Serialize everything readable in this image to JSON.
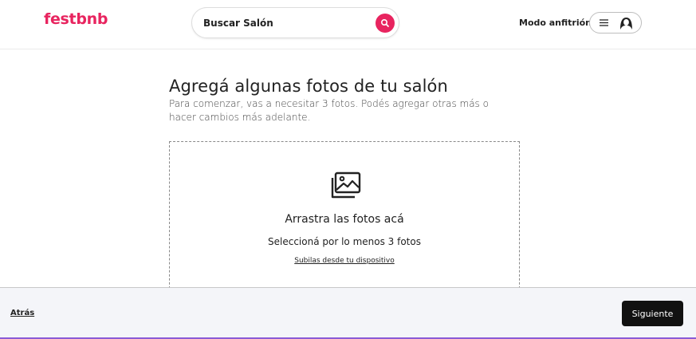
{
  "header": {
    "logo": "festbnb",
    "search": {
      "placeholder": "Buscar Salón",
      "icon": "search-icon"
    },
    "host_link": "Modo anfitrión",
    "user_menu": {
      "menu_icon": "hamburger-icon",
      "avatar_icon": "user-avatar-icon"
    }
  },
  "main": {
    "title": "Agregá algunas fotos de tu salón",
    "subtitle": "Para comenzar, vas a necesitar 3 fotos. Podés agregar otras más o hacer cambios más adelante.",
    "dropzone": {
      "icon": "photos-icon",
      "title": "Arrastra las fotos acá",
      "subtitle": "Seleccioná por lo menos 3 fotos",
      "upload_link": "Subilas desde tu dispositivo"
    }
  },
  "footer": {
    "back_label": "Atrás",
    "next_label": "Siguiente"
  },
  "colors": {
    "brand": "#e8245f",
    "button_dark": "#111111",
    "footer_bg": "#f4f5f9"
  }
}
